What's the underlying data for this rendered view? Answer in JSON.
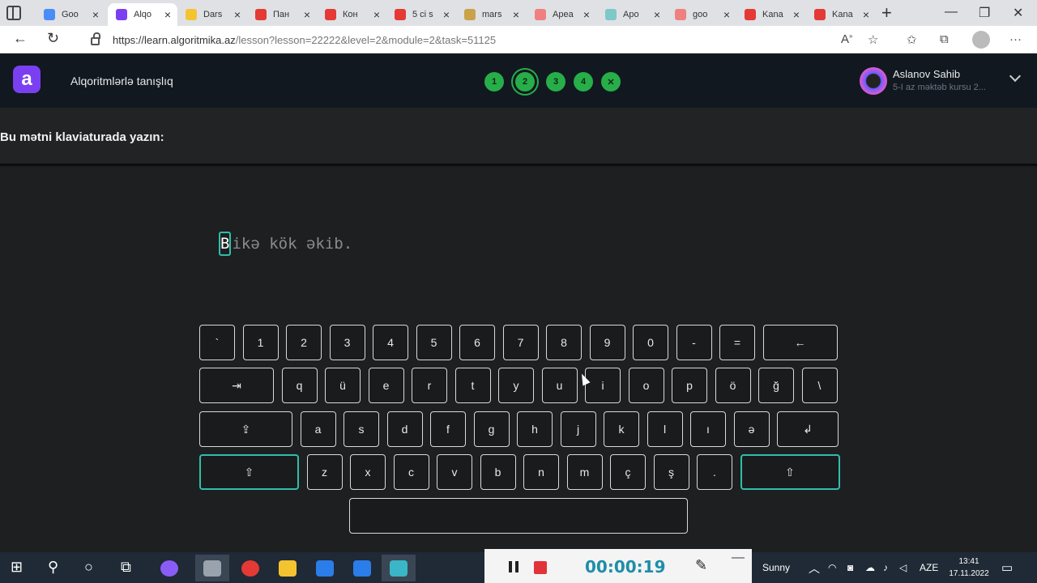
{
  "browser": {
    "tabs": [
      {
        "title": "Goo",
        "favicon_color": "#4a8df8",
        "active": false
      },
      {
        "title": "Alqo",
        "favicon_color": "#7b3ff2",
        "active": true
      },
      {
        "title": "Dars",
        "favicon_color": "#f4c430",
        "active": false
      },
      {
        "title": "Пан",
        "favicon_color": "#e53935",
        "active": false
      },
      {
        "title": "Кон",
        "favicon_color": "#e53935",
        "active": false
      },
      {
        "title": "5 ci s",
        "favicon_color": "#e53935",
        "active": false
      },
      {
        "title": "mars",
        "favicon_color": "#c9a24a",
        "active": false
      },
      {
        "title": "Apea",
        "favicon_color": "#f08080",
        "active": false
      },
      {
        "title": "Apo",
        "favicon_color": "#7ec8c8",
        "active": false
      },
      {
        "title": "goo",
        "favicon_color": "#f08080",
        "active": false
      },
      {
        "title": "Kana",
        "favicon_color": "#e53935",
        "active": false
      },
      {
        "title": "Kana",
        "favicon_color": "#e53935",
        "active": false
      }
    ],
    "url_host": "https://learn.algoritmika.az",
    "url_path": "/lesson?lesson=22222&level=2&module=2&task=51125"
  },
  "app": {
    "logo_letter": "a",
    "course_title": "Alqoritmlərlə tanışlıq",
    "steps": [
      "1",
      "2",
      "3",
      "4",
      ""
    ],
    "current_step": "2",
    "user": {
      "name": "Aslanov Sahib",
      "subtitle": "5-I az məktəb kursu 2..."
    }
  },
  "task": {
    "instruction": "Bu mətni klaviaturada yazın:",
    "cursor_char": "B",
    "remaining_text": "ikə kök əkib."
  },
  "keyboard": {
    "rows": [
      [
        "`",
        "1",
        "2",
        "3",
        "4",
        "5",
        "6",
        "7",
        "8",
        "9",
        "0",
        "-",
        "=",
        "←"
      ],
      [
        "⇥",
        "q",
        "ü",
        "e",
        "r",
        "t",
        "y",
        "u",
        "i",
        "o",
        "p",
        "ö",
        "ğ",
        "\\"
      ],
      [
        "⇪",
        "a",
        "s",
        "d",
        "f",
        "g",
        "h",
        "j",
        "k",
        "l",
        "ı",
        "ə",
        "↲"
      ],
      [
        "⇧",
        "z",
        "x",
        "c",
        "v",
        "b",
        "n",
        "m",
        "ç",
        "ş",
        ".",
        "⇧"
      ],
      [
        ""
      ]
    ]
  },
  "recorder": {
    "time": "00:00:19"
  },
  "taskbar": {
    "weather": "Sunny",
    "language": "AZE",
    "time": "13:41",
    "date": "17.11.2022"
  }
}
